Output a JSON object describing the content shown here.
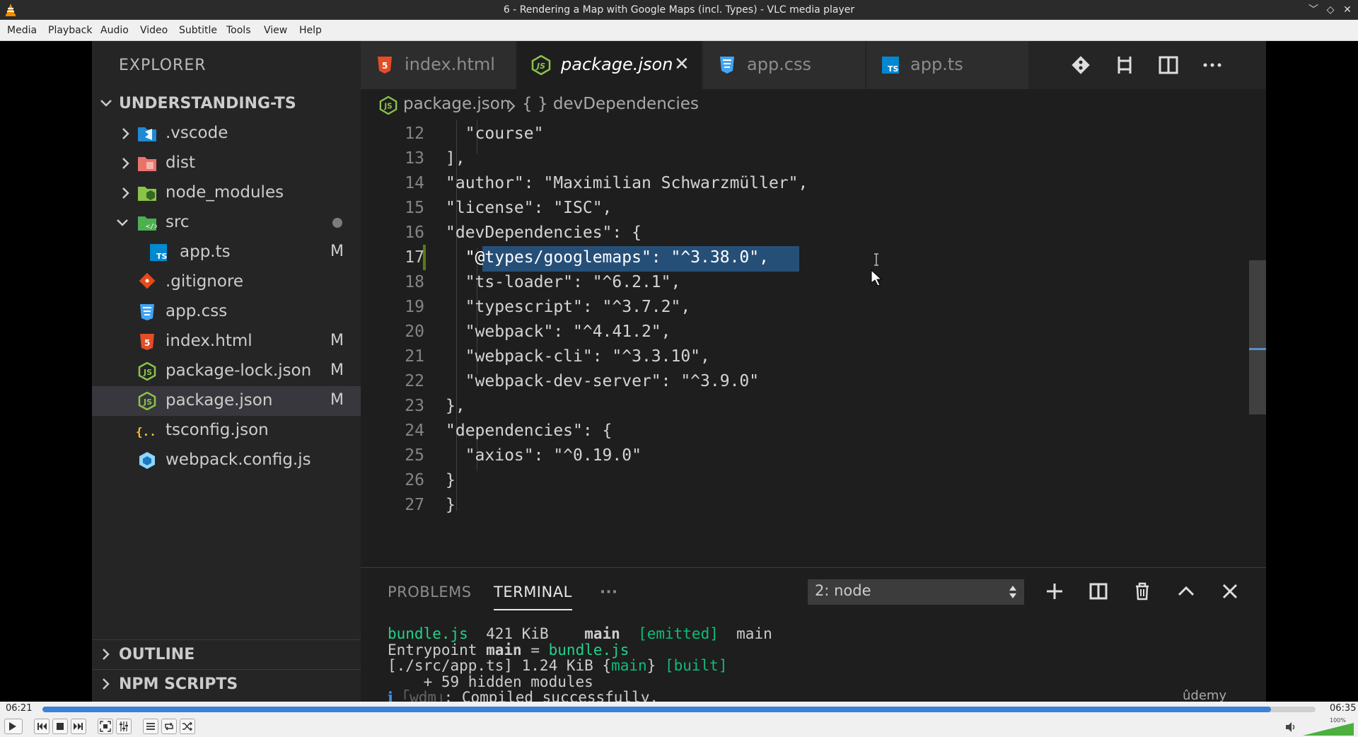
{
  "window": {
    "title": "6 - Rendering a Map with Google Maps (incl. Types) - VLC media player"
  },
  "menu": [
    "Media",
    "Playback",
    "Audio",
    "Video",
    "Subtitle",
    "Tools",
    "View",
    "Help"
  ],
  "explorer": {
    "title": "EXPLORER",
    "project": "UNDERSTANDING-TS",
    "items": [
      {
        "name": ".vscode",
        "status": ""
      },
      {
        "name": "dist",
        "status": ""
      },
      {
        "name": "node_modules",
        "status": ""
      },
      {
        "name": "src",
        "status": ""
      },
      {
        "name": "app.ts",
        "status": "M"
      },
      {
        "name": ".gitignore",
        "status": ""
      },
      {
        "name": "app.css",
        "status": ""
      },
      {
        "name": "index.html",
        "status": "M"
      },
      {
        "name": "package-lock.json",
        "status": "M"
      },
      {
        "name": "package.json",
        "status": "M"
      },
      {
        "name": "tsconfig.json",
        "status": ""
      },
      {
        "name": "webpack.config.js",
        "status": ""
      }
    ],
    "outline": "OUTLINE",
    "npm_scripts": "NPM SCRIPTS"
  },
  "tabs": [
    {
      "label": "index.html"
    },
    {
      "label": "package.json"
    },
    {
      "label": "app.css"
    },
    {
      "label": "app.ts"
    }
  ],
  "breadcrumb": {
    "file": "package.json",
    "symbol": "{ } devDependencies"
  },
  "editor": {
    "lines": [
      {
        "n": "12",
        "text": "  \"course\""
      },
      {
        "n": "13",
        "text": "],"
      },
      {
        "n": "14",
        "text": "\"author\": \"Maximilian Schwarzmüller\","
      },
      {
        "n": "15",
        "text": "\"license\": \"ISC\","
      },
      {
        "n": "16",
        "text": "\"devDependencies\": {"
      },
      {
        "n": "17",
        "text": "  \"@types/googlemaps\": \"^3.38.0\","
      },
      {
        "n": "18",
        "text": "  \"ts-loader\": \"^6.2.1\","
      },
      {
        "n": "19",
        "text": "  \"typescript\": \"^3.7.2\","
      },
      {
        "n": "20",
        "text": "  \"webpack\": \"^4.41.2\","
      },
      {
        "n": "21",
        "text": "  \"webpack-cli\": \"^3.3.10\","
      },
      {
        "n": "22",
        "text": "  \"webpack-dev-server\": \"^3.9.0\""
      },
      {
        "n": "23",
        "text": "},"
      },
      {
        "n": "24",
        "text": "\"dependencies\": {"
      },
      {
        "n": "25",
        "text": "  \"axios\": \"^0.19.0\""
      },
      {
        "n": "26",
        "text": "}"
      },
      {
        "n": "27",
        "text": "}"
      }
    ]
  },
  "panel": {
    "tabs": [
      "PROBLEMS",
      "TERMINAL",
      "···"
    ],
    "terminal_select": "2: node",
    "terminal": {
      "l1_file": "bundle.js",
      "l1_size": "421 KiB",
      "l1_chunk": "main",
      "l1_flag": "[emitted]",
      "l1_name": "main",
      "l2_prefix": "Entrypoint",
      "l2_main": "main",
      "l2_eq": "=",
      "l2_file": "bundle.js",
      "l3_path": "[./src/app.ts] 1.24 KiB {",
      "l3_main": "main",
      "l3_close": "}",
      "l3_built": "[built]",
      "l4": "    + 59 hidden modules",
      "l5_i": "ℹ",
      "l5_wdm": "｢wdm｣",
      "l5_msg": ": Compiled successfully."
    },
    "watermark": "ûdemy"
  },
  "player": {
    "elapsed": "06:21",
    "total": "06:35",
    "progress": 0.965,
    "volume_label": "100%",
    "volume": 1.0
  }
}
